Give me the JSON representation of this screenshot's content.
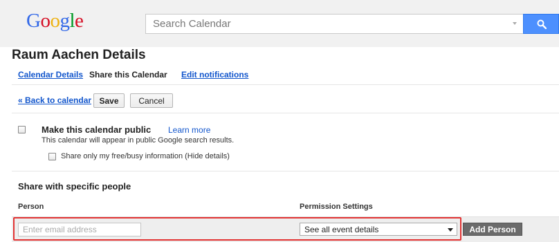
{
  "header": {
    "logo": {
      "letters": [
        "G",
        "o",
        "o",
        "g",
        "l",
        "e"
      ],
      "colors": [
        "#3369e8",
        "#d50f25",
        "#eeb211",
        "#3369e8",
        "#009925",
        "#d50f25"
      ]
    },
    "search": {
      "placeholder": "Search Calendar",
      "button_icon": "search-icon"
    },
    "accent_color": "#4d90fe"
  },
  "page": {
    "title": "Raum Aachen Details",
    "tabs": [
      {
        "label": "Calendar Details",
        "active": false
      },
      {
        "label": "Share this Calendar",
        "active": true
      },
      {
        "label": "Edit notifications",
        "active": false
      }
    ]
  },
  "actions": {
    "back_label": "« Back to calendar",
    "save_label": "Save",
    "cancel_label": "Cancel"
  },
  "public_section": {
    "title": "Make this calendar public",
    "learn_more": "Learn more",
    "description": "This calendar will appear in public Google search results.",
    "freebusy_label": "Share only my free/busy information (Hide details)",
    "public_checked": false,
    "freebusy_checked": false
  },
  "share_section": {
    "heading": "Share with specific people",
    "columns": {
      "person": "Person",
      "permission": "Permission Settings"
    },
    "email_placeholder": "Enter email address",
    "permission_selected": "See all event details",
    "add_person_label": "Add Person",
    "highlight_color": "#e23333"
  }
}
